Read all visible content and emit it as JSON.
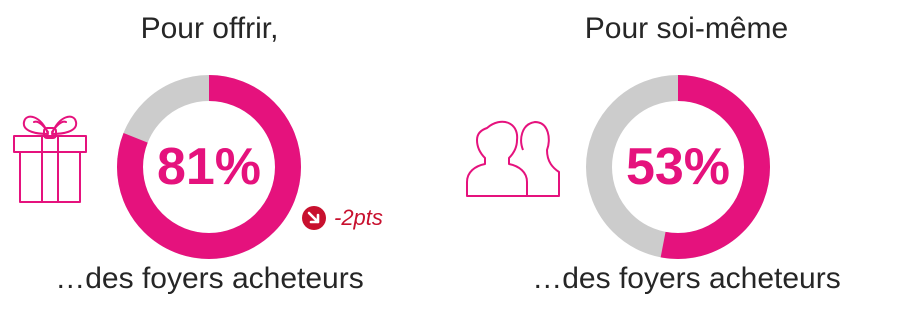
{
  "colors": {
    "accent": "#e5127d",
    "track": "#cccccc",
    "text": "#262626",
    "delta": "#c8102e"
  },
  "chart_data": [
    {
      "type": "pie",
      "title": "Pour offrir,",
      "caption": "…des foyers acheteurs",
      "value": 81,
      "value_label": "81%",
      "icon": "gift-icon",
      "delta": {
        "label": "-2pts",
        "direction": "down",
        "icon": "arrow-down-right-icon"
      }
    },
    {
      "type": "pie",
      "title": "Pour soi-même",
      "caption": "…des foyers acheteurs",
      "value": 53,
      "value_label": "53%",
      "icon": "people-icon"
    }
  ]
}
